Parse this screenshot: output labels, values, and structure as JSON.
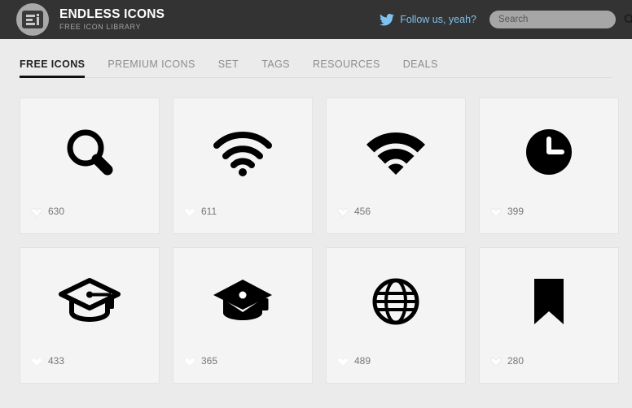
{
  "header": {
    "logo_icon": "endless-icons-logo",
    "brand_title": "ENDLESS ICONS",
    "brand_subtitle": "FREE ICON LIBRARY",
    "twitter_icon": "twitter-bird-icon",
    "follow_label": "Follow us, yeah?",
    "search": {
      "placeholder": "Search",
      "value": "",
      "icon": "search-icon"
    },
    "background_color": "#333333",
    "accent_color": "#7dc2ef"
  },
  "nav": {
    "items": [
      {
        "label": "FREE ICONS",
        "active": true
      },
      {
        "label": "PREMIUM ICONS",
        "active": false
      },
      {
        "label": "SET",
        "active": false
      },
      {
        "label": "TAGS",
        "active": false
      },
      {
        "label": "RESOURCES",
        "active": false
      },
      {
        "label": "DEALS",
        "active": false
      }
    ]
  },
  "grid": {
    "like_icon": "heart-icon",
    "cards": [
      {
        "icon": "magnifier-icon",
        "likes": "630"
      },
      {
        "icon": "wifi-outline-icon",
        "likes": "611"
      },
      {
        "icon": "wifi-filled-icon",
        "likes": "456"
      },
      {
        "icon": "clock-filled-icon",
        "likes": "399"
      },
      {
        "icon": "graduation-cap-outline-icon",
        "likes": "433"
      },
      {
        "icon": "graduation-cap-filled-icon",
        "likes": "365"
      },
      {
        "icon": "globe-icon",
        "likes": "489"
      },
      {
        "icon": "bookmark-filled-icon",
        "likes": "280"
      }
    ]
  },
  "colors": {
    "page_background": "#ebebeb",
    "card_background": "#f4f4f4",
    "card_border": "#e3e3e3",
    "icon_color": "#000000",
    "nav_inactive": "#8c8c8c",
    "nav_active": "#222222"
  }
}
